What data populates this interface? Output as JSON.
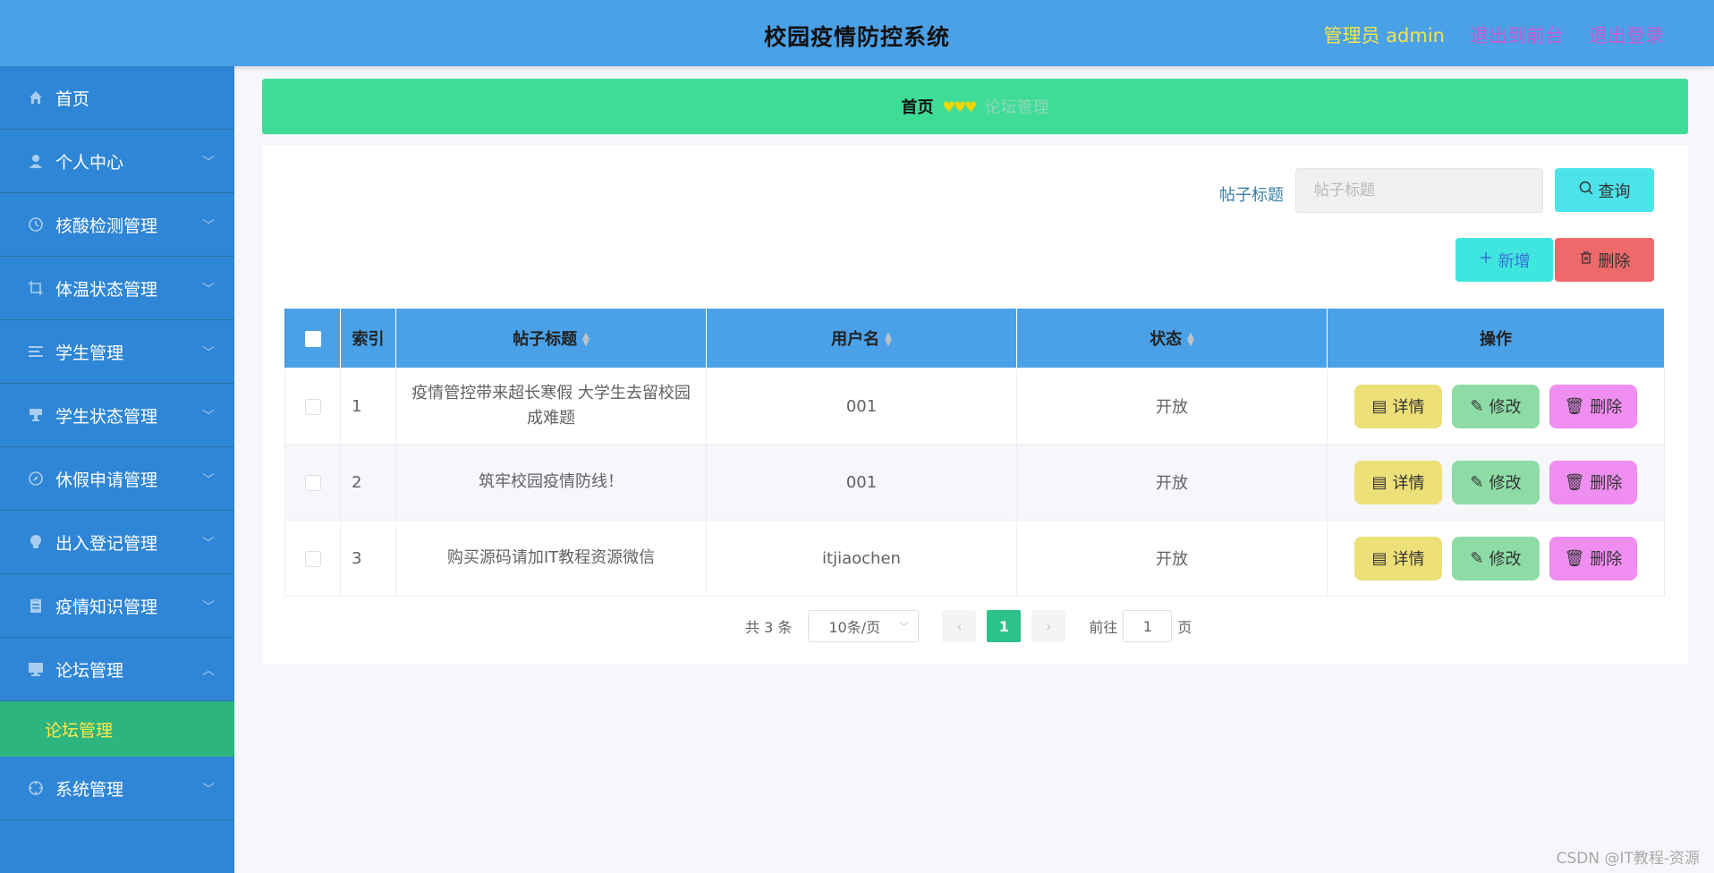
{
  "header": {
    "title": "校园疫情防控系统",
    "admin_label": "管理员 admin",
    "to_front": "退出到前台",
    "logout": "退出登录"
  },
  "sidebar": {
    "items": [
      {
        "label": "首页",
        "icon": "home-icon",
        "chevron": ""
      },
      {
        "label": "个人中心",
        "icon": "user-icon",
        "chevron": "﹀"
      },
      {
        "label": "核酸检测管理",
        "icon": "clock-icon",
        "chevron": "﹀"
      },
      {
        "label": "体温状态管理",
        "icon": "crop-icon",
        "chevron": "﹀"
      },
      {
        "label": "学生管理",
        "icon": "list-icon",
        "chevron": "﹀"
      },
      {
        "label": "学生状态管理",
        "icon": "stamp-icon",
        "chevron": "﹀"
      },
      {
        "label": "休假申请管理",
        "icon": "compass-icon",
        "chevron": "﹀"
      },
      {
        "label": "出入登记管理",
        "icon": "bulb-icon",
        "chevron": "﹀"
      },
      {
        "label": "疫情知识管理",
        "icon": "document-icon",
        "chevron": "﹀"
      },
      {
        "label": "论坛管理",
        "icon": "monitor-icon",
        "chevron": "︿"
      }
    ],
    "subitem": "论坛管理",
    "last_item": {
      "label": "系统管理",
      "icon": "aim-icon",
      "chevron": "﹀"
    }
  },
  "breadcrumb": {
    "home": "首页",
    "separator": "♥♥♥",
    "current": "论坛管理"
  },
  "search": {
    "label": "帖子标题",
    "placeholder": "帖子标题",
    "query_button": "查询"
  },
  "toolbar": {
    "add_label": "新增",
    "delete_label": "删除"
  },
  "table": {
    "headers": [
      "索引",
      "帖子标题",
      "用户名",
      "状态",
      "操作"
    ],
    "rows": [
      {
        "index": "1",
        "title": "疫情管控带来超长寒假 大学生去留校园成难题",
        "username": "001",
        "status": "开放"
      },
      {
        "index": "2",
        "title": "筑牢校园疫情防线！",
        "username": "001",
        "status": "开放"
      },
      {
        "index": "3",
        "title": "购买源码请加IT教程资源微信",
        "username": "itjiaochen",
        "status": "开放"
      }
    ],
    "ops": {
      "detail": "详情",
      "edit": "修改",
      "delete": "删除"
    }
  },
  "pagination": {
    "total": "共 3 条",
    "page_size": "10条/页",
    "current_page": "1",
    "goto_prefix": "前往",
    "goto_value": "1",
    "goto_suffix": "页"
  },
  "watermark": "CSDN @IT教程-资源",
  "colors": {
    "header_bg": "#4aa1e8",
    "sidebar_bg": "#2f86d6",
    "sidebar_active_bg": "#2cb57e",
    "breadcrumb_bg": "#3fdc98",
    "page_active": "#2cc28a"
  }
}
